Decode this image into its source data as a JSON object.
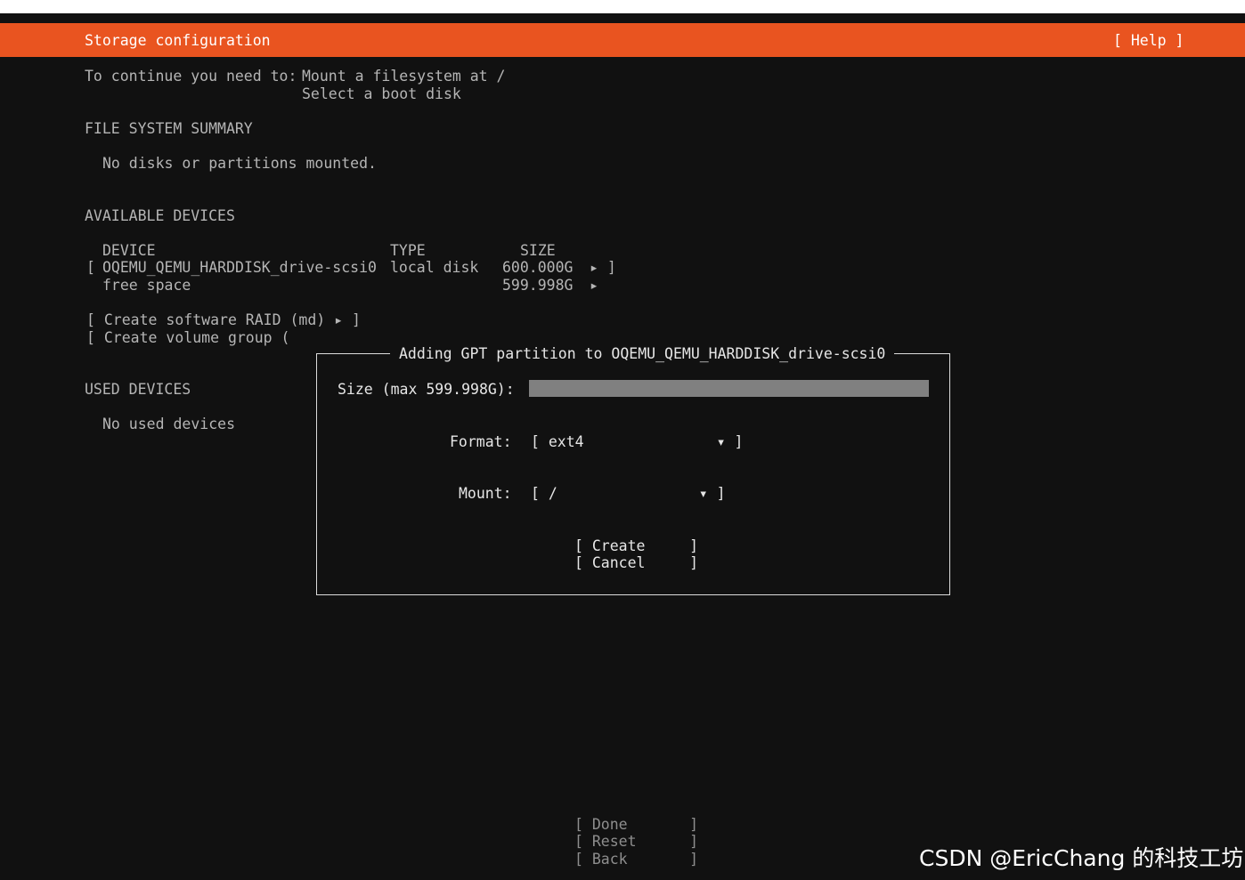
{
  "header": {
    "title": "Storage configuration",
    "help_label": "[ Help ]"
  },
  "requirements": {
    "prefix": "To continue you need to:",
    "items": [
      "Mount a filesystem at /",
      "Select a boot disk"
    ]
  },
  "fs_summary": {
    "heading": "FILE SYSTEM SUMMARY",
    "empty_text": "No disks or partitions mounted."
  },
  "available": {
    "heading": "AVAILABLE DEVICES",
    "columns": {
      "device": "DEVICE",
      "type": "TYPE",
      "size": "SIZE"
    },
    "rows": [
      {
        "bracket_open": "[",
        "device": "OQEMU_QEMU_HARDDISK_drive-scsi0",
        "type": "local disk",
        "size": "600.000G",
        "arrow": "▸ ]"
      },
      {
        "device": "free space",
        "size": "599.998G",
        "arrow": "▸"
      }
    ],
    "actions": [
      "[ Create software RAID (md) ▸ ]",
      "[ Create volume group ("
    ]
  },
  "used": {
    "heading": "USED DEVICES",
    "empty_text": "No used devices"
  },
  "dialog": {
    "title": "Adding GPT partition to OQEMU_QEMU_HARDDISK_drive-scsi0",
    "size_label": "Size (max 599.998G):",
    "size_value": "",
    "format_label": "Format:",
    "format_value": "[ ext4               ▾ ]",
    "mount_label": "Mount:",
    "mount_value": "[ /                ▾ ]",
    "create_label": "[ Create     ]",
    "cancel_label": "[ Cancel     ]"
  },
  "footer": {
    "done_label": "[ Done       ]",
    "reset_label": "[ Reset      ]",
    "back_label": "[ Back       ]"
  },
  "watermark": "CSDN @EricChang 的科技工坊",
  "colors": {
    "header": "#e95420",
    "background": "#111111"
  }
}
